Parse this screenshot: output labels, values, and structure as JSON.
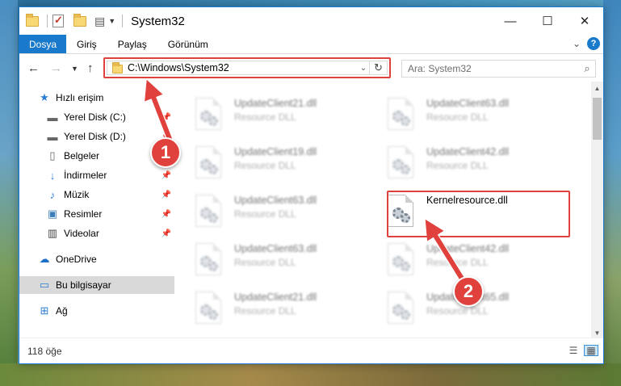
{
  "window": {
    "title": "System32",
    "controls": {
      "minimize": "—",
      "maximize": "☐",
      "close": "✕"
    }
  },
  "quick_access_toolbar": {
    "icons": [
      "folder-icon",
      "properties-check-icon",
      "new-folder-icon",
      "customize-icon"
    ]
  },
  "ribbon": {
    "tabs": [
      {
        "label": "Dosya",
        "active": true
      },
      {
        "label": "Giriş"
      },
      {
        "label": "Paylaş"
      },
      {
        "label": "Görünüm"
      }
    ],
    "help_label": "?"
  },
  "address_bar": {
    "path": "C:\\Windows\\System32"
  },
  "search": {
    "placeholder": "Ara: System32"
  },
  "nav_pane": {
    "items": [
      {
        "label": "Hızlı erişim",
        "icon": "star-icon"
      },
      {
        "label": "Yerel Disk (C:)",
        "icon": "drive-icon",
        "pinned": true
      },
      {
        "label": "Yerel Disk (D:)",
        "icon": "drive-icon",
        "pinned": true
      },
      {
        "label": "Belgeler",
        "icon": "documents-icon",
        "pinned": true
      },
      {
        "label": "İndirmeler",
        "icon": "download-icon",
        "pinned": true
      },
      {
        "label": "Müzik",
        "icon": "music-icon",
        "pinned": true
      },
      {
        "label": "Resimler",
        "icon": "pictures-icon",
        "pinned": true
      },
      {
        "label": "Videolar",
        "icon": "video-icon",
        "pinned": true
      },
      {
        "label": "OneDrive",
        "icon": "cloud-icon"
      },
      {
        "label": "Bu bilgisayar",
        "icon": "computer-icon",
        "selected": true
      },
      {
        "label": "Ağ",
        "icon": "network-icon"
      }
    ]
  },
  "files": [
    {
      "name": "UpdateClient21.dll",
      "type": "Resource DLL",
      "blurred": true
    },
    {
      "name": "UpdateClient63.dll",
      "type": "Resource DLL",
      "blurred": true
    },
    {
      "name": "UpdateClient19.dll",
      "type": "Resource DLL",
      "blurred": true
    },
    {
      "name": "UpdateClient42.dll",
      "type": "Resource DLL",
      "blurred": true
    },
    {
      "name": "UpdateClient63.dll",
      "type": "Resource DLL",
      "blurred": true
    },
    {
      "name": "Kernelresource.dll",
      "type": "",
      "blurred": false
    },
    {
      "name": "UpdateClient63.dll",
      "type": "Resource DLL",
      "blurred": true
    },
    {
      "name": "UpdateClient42.dll",
      "type": "Resource DLL",
      "blurred": true
    },
    {
      "name": "UpdateClient21.dll",
      "type": "Resource DLL",
      "blurred": true
    },
    {
      "name": "UpdateClient65.dll",
      "type": "Resource DLL",
      "blurred": true
    }
  ],
  "status_bar": {
    "item_count": "118 öğe"
  },
  "annotations": {
    "step1": "1",
    "step2": "2",
    "color": "#e0413c"
  }
}
